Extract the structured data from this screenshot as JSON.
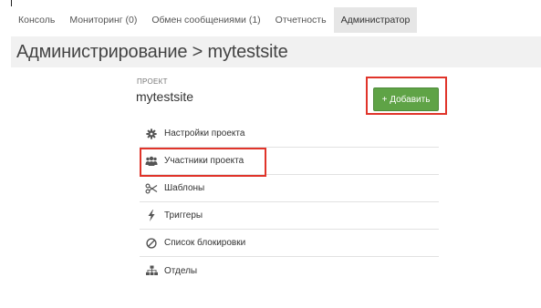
{
  "nav": {
    "tabs": [
      {
        "label": "Консоль",
        "active": false
      },
      {
        "label": "Мониторинг (0)",
        "active": false
      },
      {
        "label": "Обмен сообщениями (1)",
        "active": false
      },
      {
        "label": "Отчетность",
        "active": false
      },
      {
        "label": "Администратор",
        "active": true
      }
    ]
  },
  "header": {
    "title": "Администрирование > mytestsite"
  },
  "project": {
    "label": "ПРОЕКТ",
    "name": "mytestsite",
    "add_button_label": "+ Добавить"
  },
  "menu": {
    "items": [
      {
        "label": "Настройки проекта",
        "icon": "gear-icon"
      },
      {
        "label": "Участники проекта",
        "icon": "users-icon"
      },
      {
        "label": "Шаблоны",
        "icon": "scissors-icon"
      },
      {
        "label": "Триггеры",
        "icon": "lightning-icon"
      },
      {
        "label": "Список блокировки",
        "icon": "block-icon"
      },
      {
        "label": "Отделы",
        "icon": "hierarchy-icon"
      }
    ]
  },
  "colors": {
    "accent_green": "#5fa346",
    "highlight_red": "#e0342a",
    "active_tab_bg": "#e6e6e6",
    "title_bar_bg": "#f1f1f1"
  }
}
